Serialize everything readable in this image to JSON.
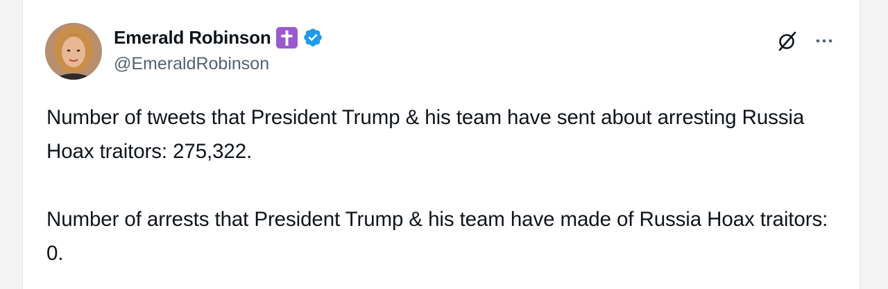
{
  "author": {
    "display_name": "Emerald Robinson",
    "handle": "@EmeraldRobinson",
    "badges": {
      "cross_icon": "latin-cross-icon",
      "cross_color": "#9b59d0",
      "verified_icon": "verified-badge-icon",
      "verified_color": "#1d9bf0"
    }
  },
  "actions": {
    "grok_icon": "grok-icon",
    "more_icon": "more-options-icon"
  },
  "tweet": {
    "paragraphs": [
      "Number of tweets that President Trump & his team have sent about arresting Russia Hoax traitors: 275,322.",
      "Number of arrests that President Trump & his team have made of Russia Hoax traitors: 0."
    ]
  },
  "colors": {
    "text_primary": "#0f1419",
    "text_secondary": "#536471",
    "background": "#ffffff"
  }
}
